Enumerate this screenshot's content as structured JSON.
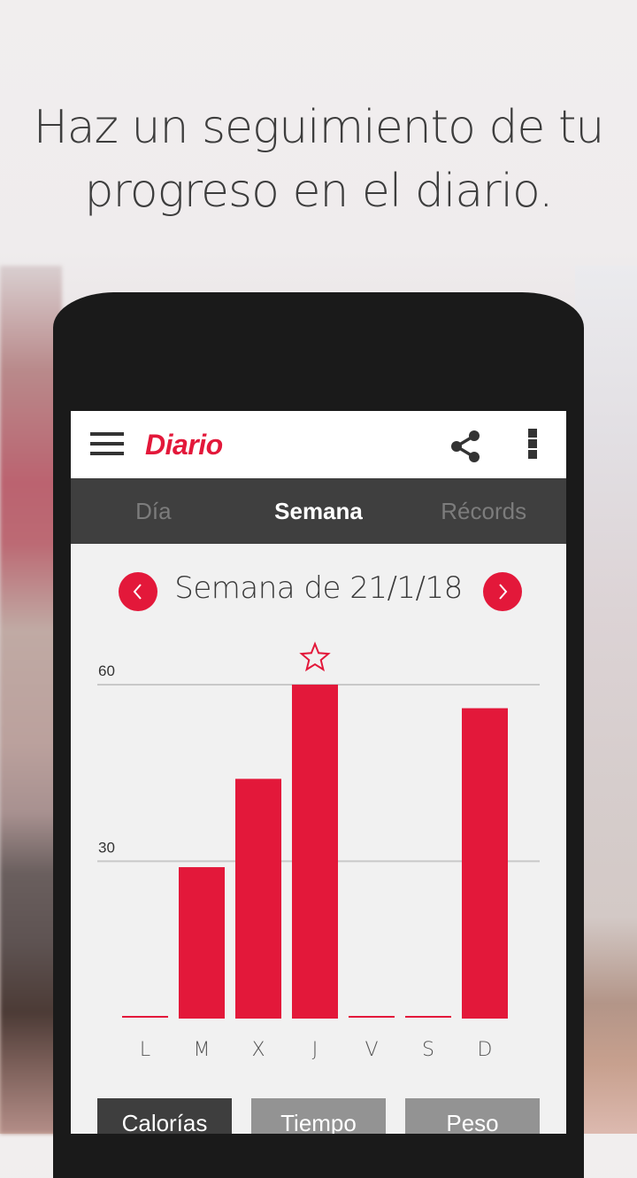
{
  "promo": {
    "headline_line1": "Haz un seguimiento de tu",
    "headline_line2": "progreso en el diario."
  },
  "appbar": {
    "title": "Diario",
    "menu_icon": "hamburger-menu-icon",
    "share_icon": "share-icon",
    "overflow_icon": "more-vertical-icon"
  },
  "tabs": [
    {
      "label": "Día",
      "active": false
    },
    {
      "label": "Semana",
      "active": true
    },
    {
      "label": "Récords",
      "active": false
    }
  ],
  "week_nav": {
    "label": "Semana de 21/1/18",
    "prev_icon": "chevron-left-icon",
    "next_icon": "chevron-right-icon"
  },
  "metric_buttons": [
    {
      "label": "Calorías",
      "active": true
    },
    {
      "label": "Tiempo",
      "active": false
    },
    {
      "label": "Peso",
      "active": false
    }
  ],
  "colors": {
    "accent": "#e3183a",
    "tabbar": "#3f3f3f",
    "gridline": "#c8c8c8"
  },
  "chart_data": {
    "type": "bar",
    "title": "",
    "xlabel": "",
    "ylabel": "",
    "categories": [
      "L",
      "M",
      "X",
      "J",
      "V",
      "S",
      "D"
    ],
    "values": [
      0,
      29,
      44,
      60,
      0,
      0,
      56
    ],
    "yticks": [
      30,
      60
    ],
    "ylim": [
      0,
      60
    ],
    "grid": true,
    "highlight": {
      "category": "J",
      "marker": "star-outline-icon",
      "meaning": "record"
    }
  }
}
